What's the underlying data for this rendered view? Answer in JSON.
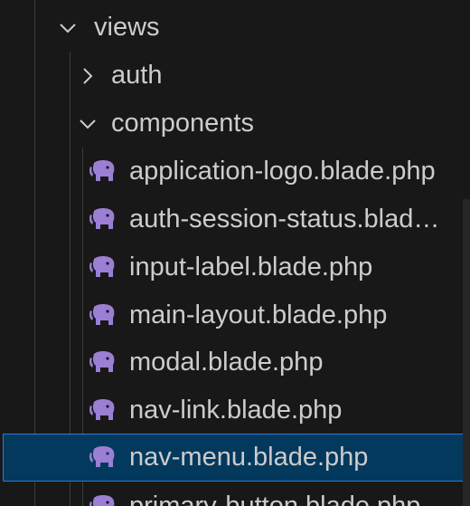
{
  "tree": {
    "folders": [
      {
        "label": "views",
        "state": "expanded"
      },
      {
        "label": "auth",
        "state": "collapsed"
      },
      {
        "label": "components",
        "state": "expanded"
      }
    ],
    "files": [
      {
        "label": "application-logo.blade.php",
        "icon": "php-elephant-icon"
      },
      {
        "label": "auth-session-status.blad…",
        "icon": "php-elephant-icon"
      },
      {
        "label": "input-label.blade.php",
        "icon": "php-elephant-icon"
      },
      {
        "label": "main-layout.blade.php",
        "icon": "php-elephant-icon"
      },
      {
        "label": "modal.blade.php",
        "icon": "php-elephant-icon"
      },
      {
        "label": "nav-link.blade.php",
        "icon": "php-elephant-icon"
      },
      {
        "label": "nav-menu.blade.php",
        "icon": "php-elephant-icon",
        "selected": true
      },
      {
        "label": "primary-button.blade.php",
        "icon": "php-elephant-icon"
      }
    ]
  },
  "colors": {
    "background": "#181818",
    "text": "#cccccc",
    "selected_background": "#04395e",
    "selected_border": "#2b79d8",
    "php_icon": "#9b7fd4",
    "indent_guide": "#3c3c3c"
  }
}
